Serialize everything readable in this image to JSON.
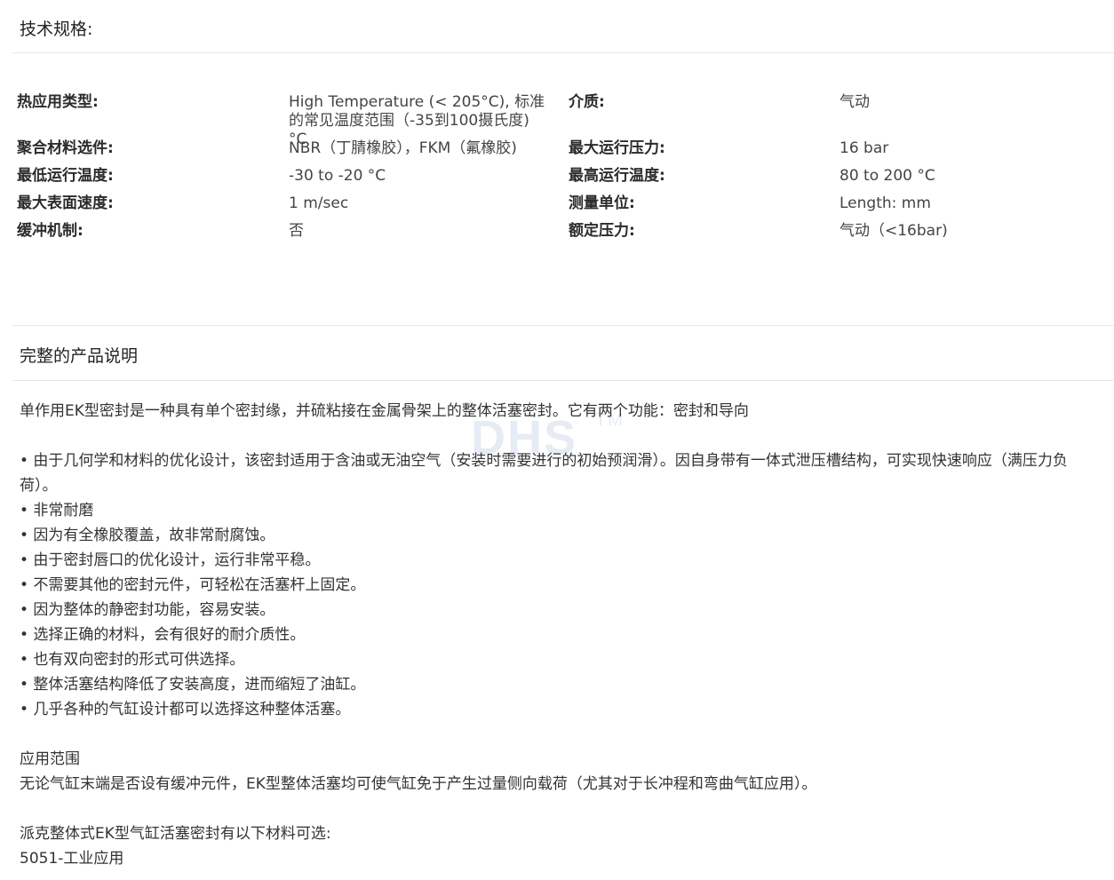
{
  "specs_section": {
    "title": "技术规格:",
    "rows": [
      {
        "left_label": "热应用类型:",
        "left_value": "High Temperature (< 205°C), 标准的常见温度范围（-35到100摄氏度) °C",
        "right_label": "介质:",
        "right_value": "气动"
      },
      {
        "left_label": "聚合材料选件:",
        "left_value": "NBR（丁腈橡胶），FKM（氟橡胶)",
        "right_label": "最大运行压力:",
        "right_value": "16 bar"
      },
      {
        "left_label": "最低运行温度:",
        "left_value": "-30 to -20 °C",
        "right_label": "最高运行温度:",
        "right_value": "80 to 200 °C"
      },
      {
        "left_label": "最大表面速度:",
        "left_value": "1 m/sec",
        "right_label": "测量单位:",
        "right_value": "Length: mm"
      },
      {
        "left_label": "缓冲机制:",
        "left_value": "否",
        "right_label": "额定压力:",
        "right_value": "气动（<16bar)"
      }
    ]
  },
  "description_section": {
    "title": "完整的产品说明",
    "intro": "单作用EK型密封是一种具有单个密封缘，并硫粘接在金属骨架上的整体活塞密封。它有两个功能：密封和导向",
    "bullets": [
      "• 由于几何学和材料的优化设计，该密封适用于含油或无油空气（安装时需要进行的初始预润滑）。因自身带有一体式泄压槽结构，可实现快速响应（满压力负荷）。",
      "• 非常耐磨",
      "• 因为有全橡胶覆盖，故非常耐腐蚀。",
      "• 由于密封唇口的优化设计，运行非常平稳。",
      "• 不需要其他的密封元件，可轻松在活塞杆上固定。",
      "• 因为整体的静密封功能，容易安装。",
      "• 选择正确的材料，会有很好的耐介质性。",
      "• 也有双向密封的形式可供选择。",
      "• 整体活塞结构降低了安装高度，进而缩短了油缸。",
      "• 几乎各种的气缸设计都可以选择这种整体活塞。"
    ],
    "application_heading": "应用范围",
    "application_text": "无论气缸末端是否设有缓冲元件，EK型整体活塞均可使气缸免于产生过量侧向载荷（尤其对于长冲程和弯曲气缸应用）。",
    "materials_heading": "派克整体式EK型气缸活塞密封有以下材料可选:",
    "materials": [
      "5051-工业应用"
    ]
  },
  "watermark": {
    "text": "DHS",
    "mark": "TM"
  }
}
